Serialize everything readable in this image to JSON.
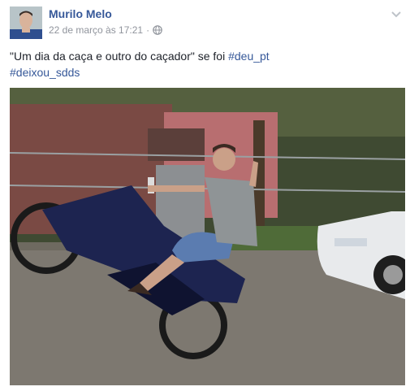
{
  "post": {
    "author_name": "Murilo Melo",
    "timestamp": "22 de março às 17:21",
    "separator": "·",
    "audience_icon": "globe-icon",
    "menu_icon": "chevron-down-icon",
    "caption": {
      "text": "\"Um dia da caça e outro do caçador\" se foi",
      "hashtags": [
        "#deu_pt",
        "#deixou_sdds"
      ]
    },
    "photo_icon": "photo-image"
  },
  "colors": {
    "link": "#365899",
    "meta": "#90949c",
    "text": "#1d2129"
  }
}
